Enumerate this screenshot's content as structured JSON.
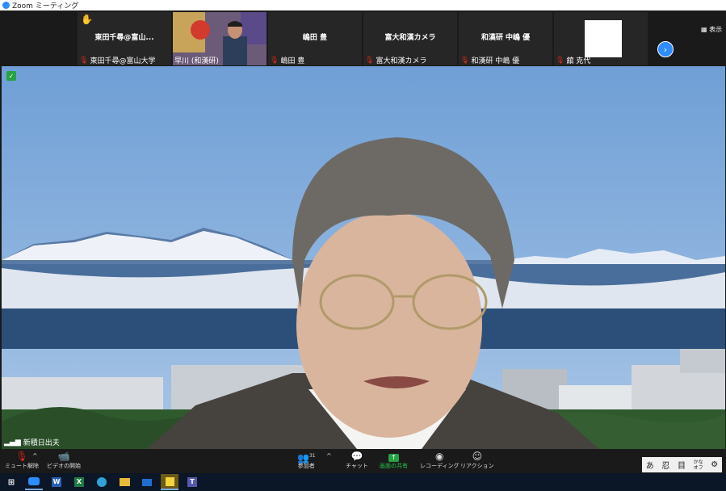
{
  "window": {
    "title": "Zoom ミーティング"
  },
  "strip": {
    "view_label": "表示",
    "tiles": [
      {
        "center": "東田千尋@富山...",
        "foot": "東田千尋@富山大学",
        "muted": true,
        "hand": true,
        "video": false
      },
      {
        "center": "",
        "foot": "早川 (和漢研)",
        "muted": false,
        "hand": false,
        "video": true
      },
      {
        "center": "嶋田 豊",
        "foot": "嶋田 豊",
        "muted": true,
        "hand": false,
        "video": false
      },
      {
        "center": "富大和漢カメラ",
        "foot": "富大和漢カメラ",
        "muted": true,
        "hand": false,
        "video": false
      },
      {
        "center": "和漢研 中嶋 優",
        "foot": "和漢研 中嶋 優",
        "muted": true,
        "hand": false,
        "video": false
      },
      {
        "center": "",
        "foot": "舘 克代",
        "muted": true,
        "hand": false,
        "video": false,
        "white_frame": true
      }
    ]
  },
  "stage": {
    "speaker_name": "新積日出夫"
  },
  "toolbar": {
    "mute": "ミュート解除",
    "video": "ビデオの開始",
    "participants": "参加者",
    "participants_count": "31",
    "chat": "チャット",
    "share": "画面の共有",
    "record": "レコーディング",
    "reactions": "リアクション"
  },
  "ime": {
    "items": [
      "あ",
      "忍",
      "目",
      "かな\nオフ",
      "⚙"
    ]
  },
  "taskbar": {
    "items": [
      "windows-start-icon",
      "zoom-icon",
      "word-icon",
      "excel-icon",
      "edge-icon",
      "explorer-icon",
      "mail-icon",
      "sticky-notes-icon",
      "teams-icon"
    ]
  },
  "colors": {
    "zoom_blue": "#2d8cff",
    "share_green": "#25a244",
    "mute_red": "#e0261b"
  }
}
